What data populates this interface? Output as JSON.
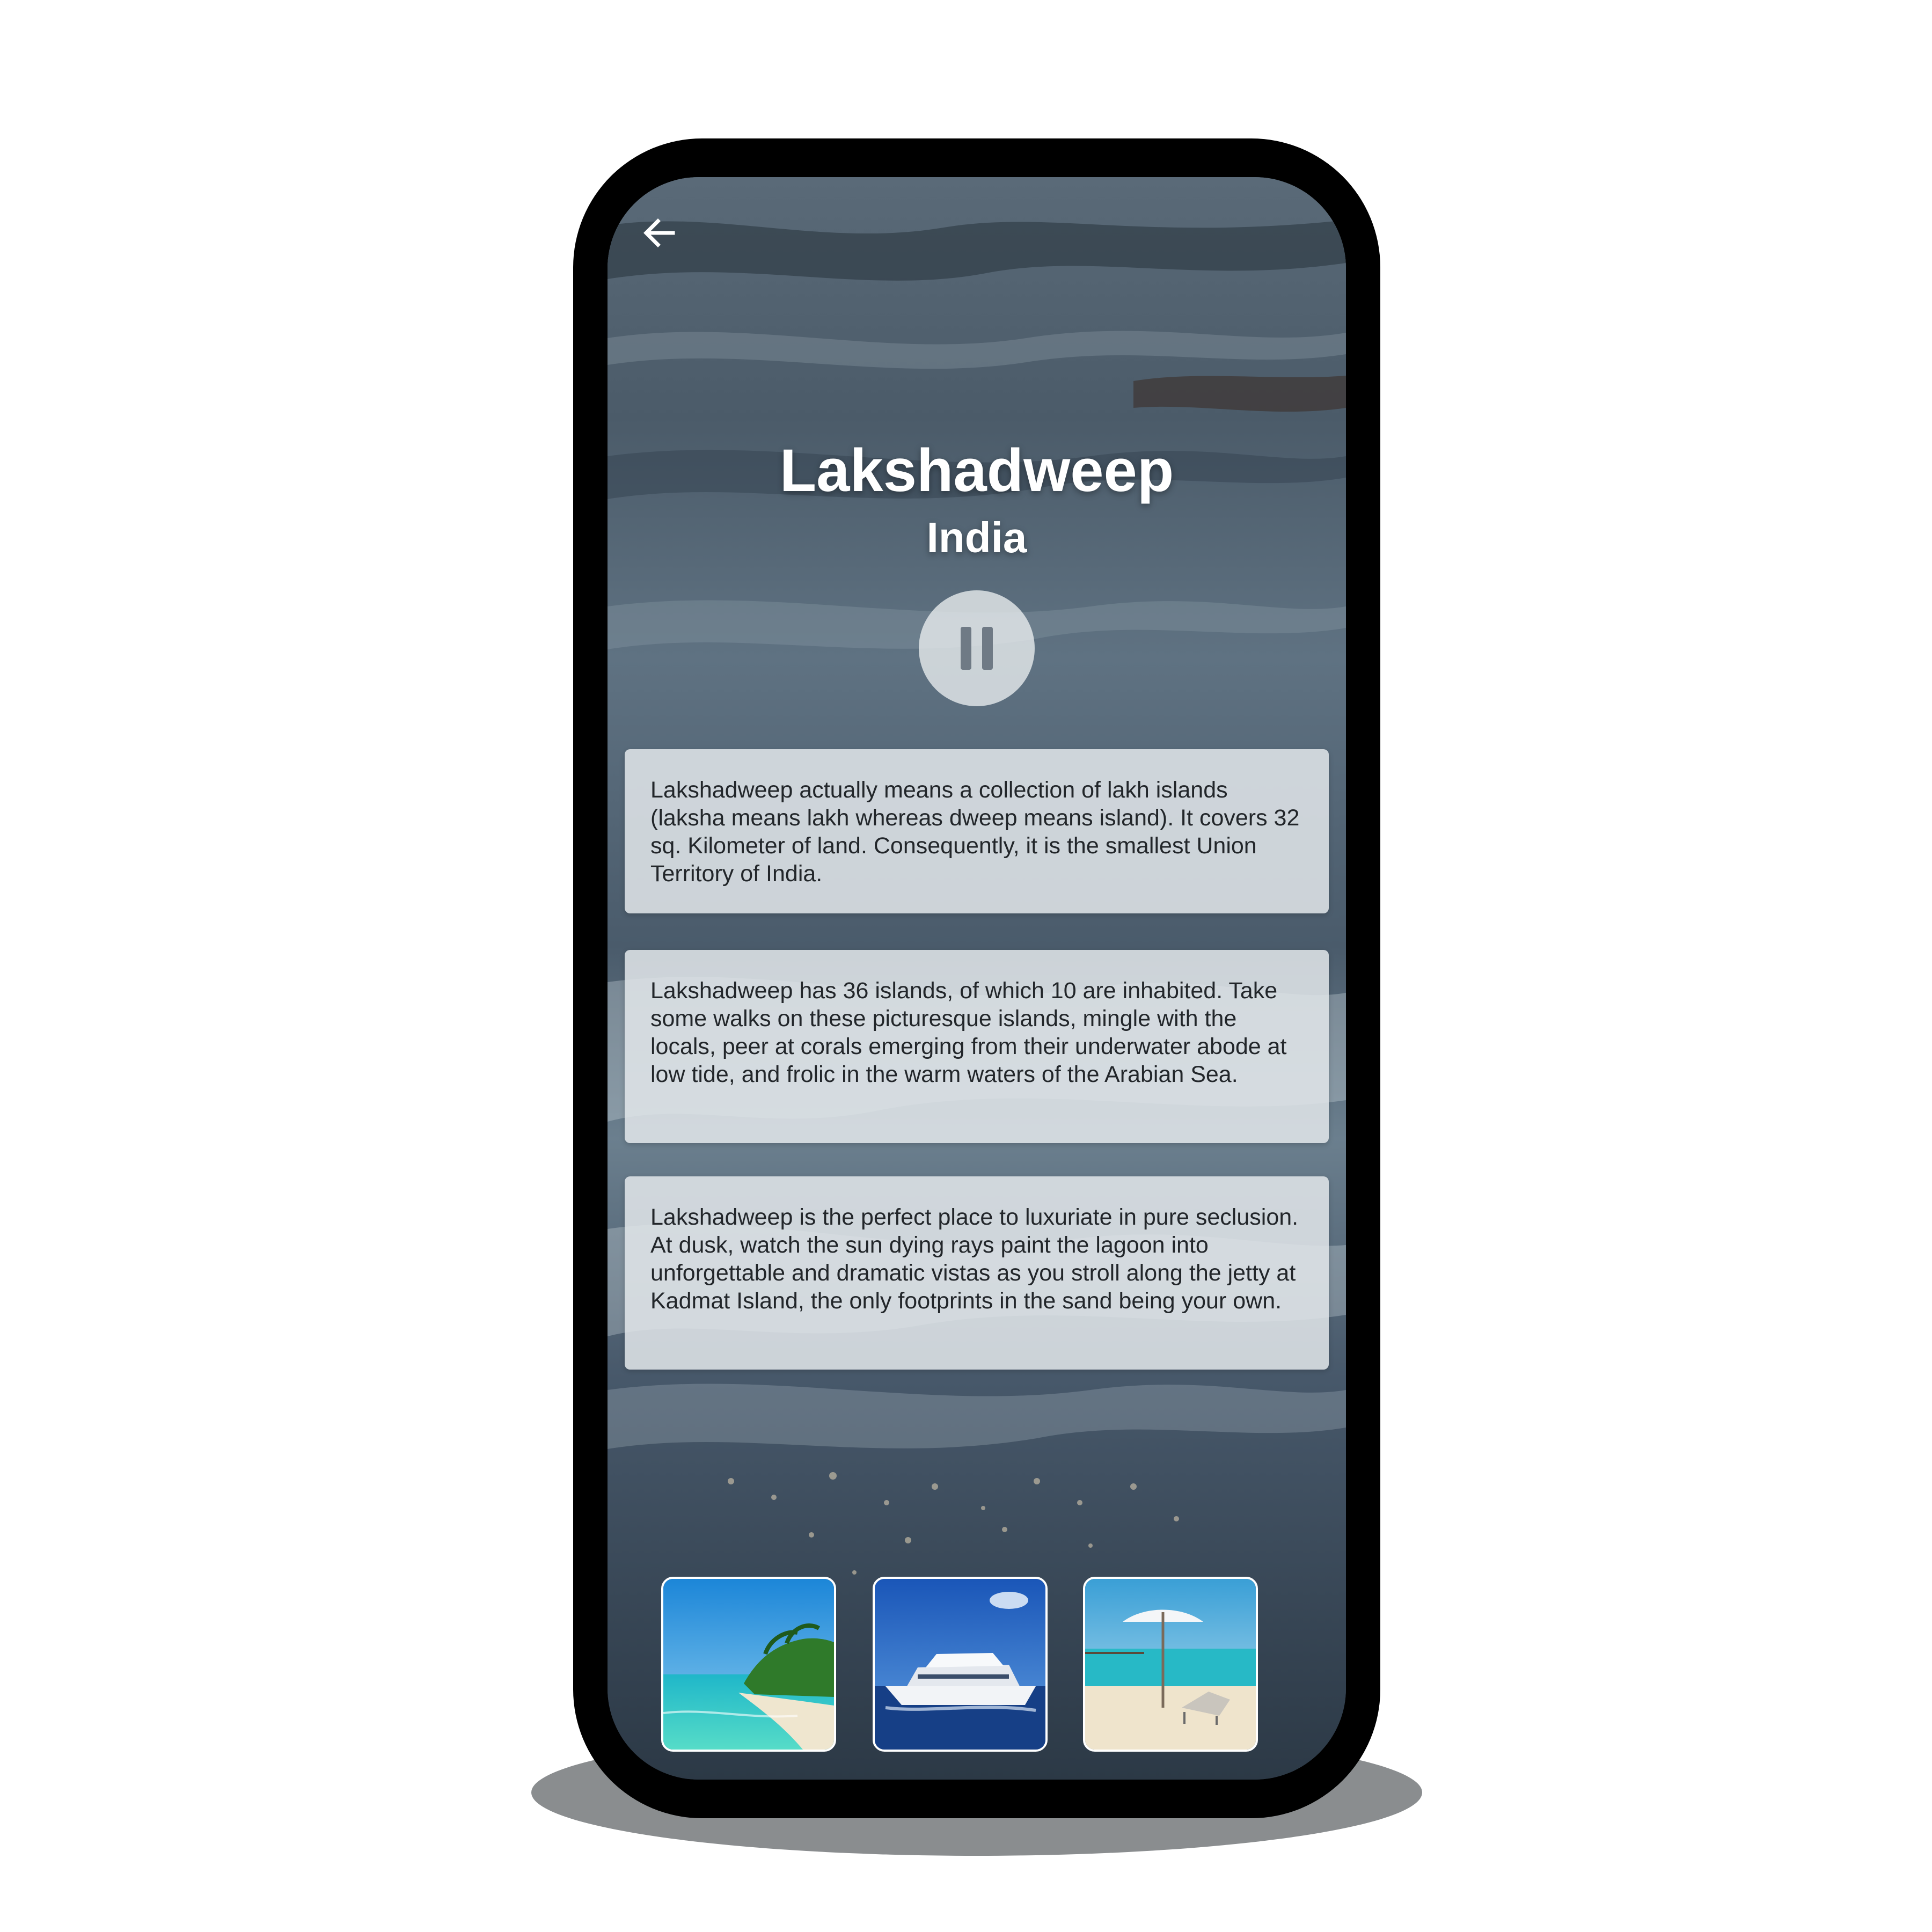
{
  "screen": {
    "back_icon": "arrow-left-icon",
    "title": "Lakshadweep",
    "subtitle": "India",
    "play_state": "playing",
    "pause_icon": "pause-icon"
  },
  "cards": [
    {
      "text": "Lakshadweep actually means a collection of lakh islands (laksha means lakh whereas dweep means island). It covers 32 sq. Kilometer of land. Consequently, it is the smallest Union Territory of India."
    },
    {
      "text": "Lakshadweep has 36 islands, of which 10 are inhabited. Take some walks on these picturesque islands, mingle with the locals, peer at corals emerging from their underwater abode at low tide, and frolic in the warm waters of the Arabian Sea."
    },
    {
      "text": "Lakshadweep is the perfect place to luxuriate in pure seclusion. At dusk, watch the sun dying rays paint the lagoon into unforgettable and dramatic vistas as you stroll along the jetty at Kadmat Island, the only footprints in the sand being your own."
    }
  ],
  "gallery": [
    {
      "subject": "island-beach-photo"
    },
    {
      "subject": "cruise-ship-photo"
    },
    {
      "subject": "beach-umbrella-photo"
    }
  ],
  "colors": {
    "phone_frame": "#000000",
    "card_background": "#e2e6ea",
    "title_text": "#ffffff",
    "body_text": "#22262a"
  }
}
